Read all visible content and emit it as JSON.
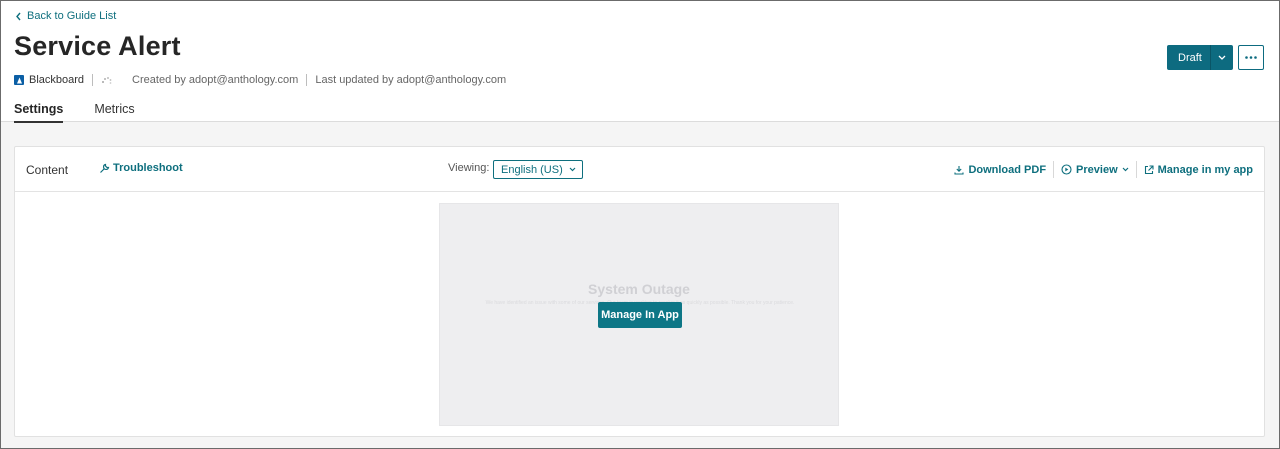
{
  "header": {
    "back_label": "Back to Guide List",
    "title": "Service Alert",
    "app_name": "Blackboard",
    "created_by": "Created by adopt@anthology.com",
    "updated_by": "Last updated by adopt@anthology.com",
    "status_button": "Draft",
    "tabs": [
      {
        "label": "Settings",
        "active": true
      },
      {
        "label": "Metrics",
        "active": false
      }
    ]
  },
  "toolbar": {
    "content_label": "Content",
    "troubleshoot_label": "Troubleshoot",
    "viewing_label": "Viewing:",
    "language_value": "English (US)",
    "download_label": "Download PDF",
    "preview_label": "Preview",
    "manage_label": "Manage in my app"
  },
  "preview": {
    "ghost_title": "System Outage",
    "ghost_text": "We have identified an issue with some of our services. Our team is working to resolve it as quickly as possible. Thank you for your patience.",
    "manage_button": "Manage In App"
  },
  "colors": {
    "accent": "#0e6f7e",
    "button": "#0d6b80"
  }
}
